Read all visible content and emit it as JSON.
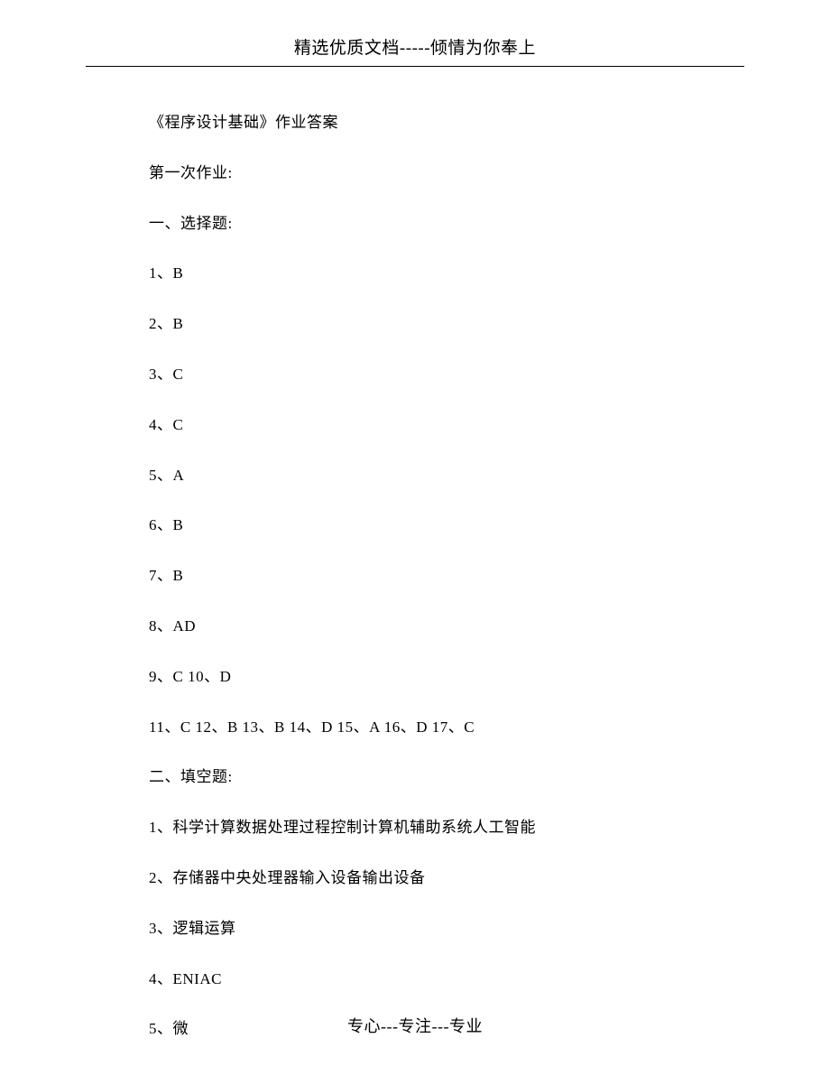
{
  "header": "精选优质文档-----倾情为你奉上",
  "lines": [
    "《程序设计基础》作业答案",
    "第一次作业:",
    "一、选择题:",
    "1、B",
    "2、B",
    "3、C",
    "4、C",
    "5、A",
    "6、B",
    "7、B",
    "8、AD",
    "9、C 10、D",
    "11、C 12、B 13、B 14、D 15、A 16、D 17、C",
    "二、填空题:",
    "1、科学计算数据处理过程控制计算机辅助系统人工智能",
    "2、存储器中央处理器输入设备输出设备",
    "3、逻辑运算",
    "4、ENIAC",
    "5、微"
  ],
  "footer": "专心---专注---专业"
}
